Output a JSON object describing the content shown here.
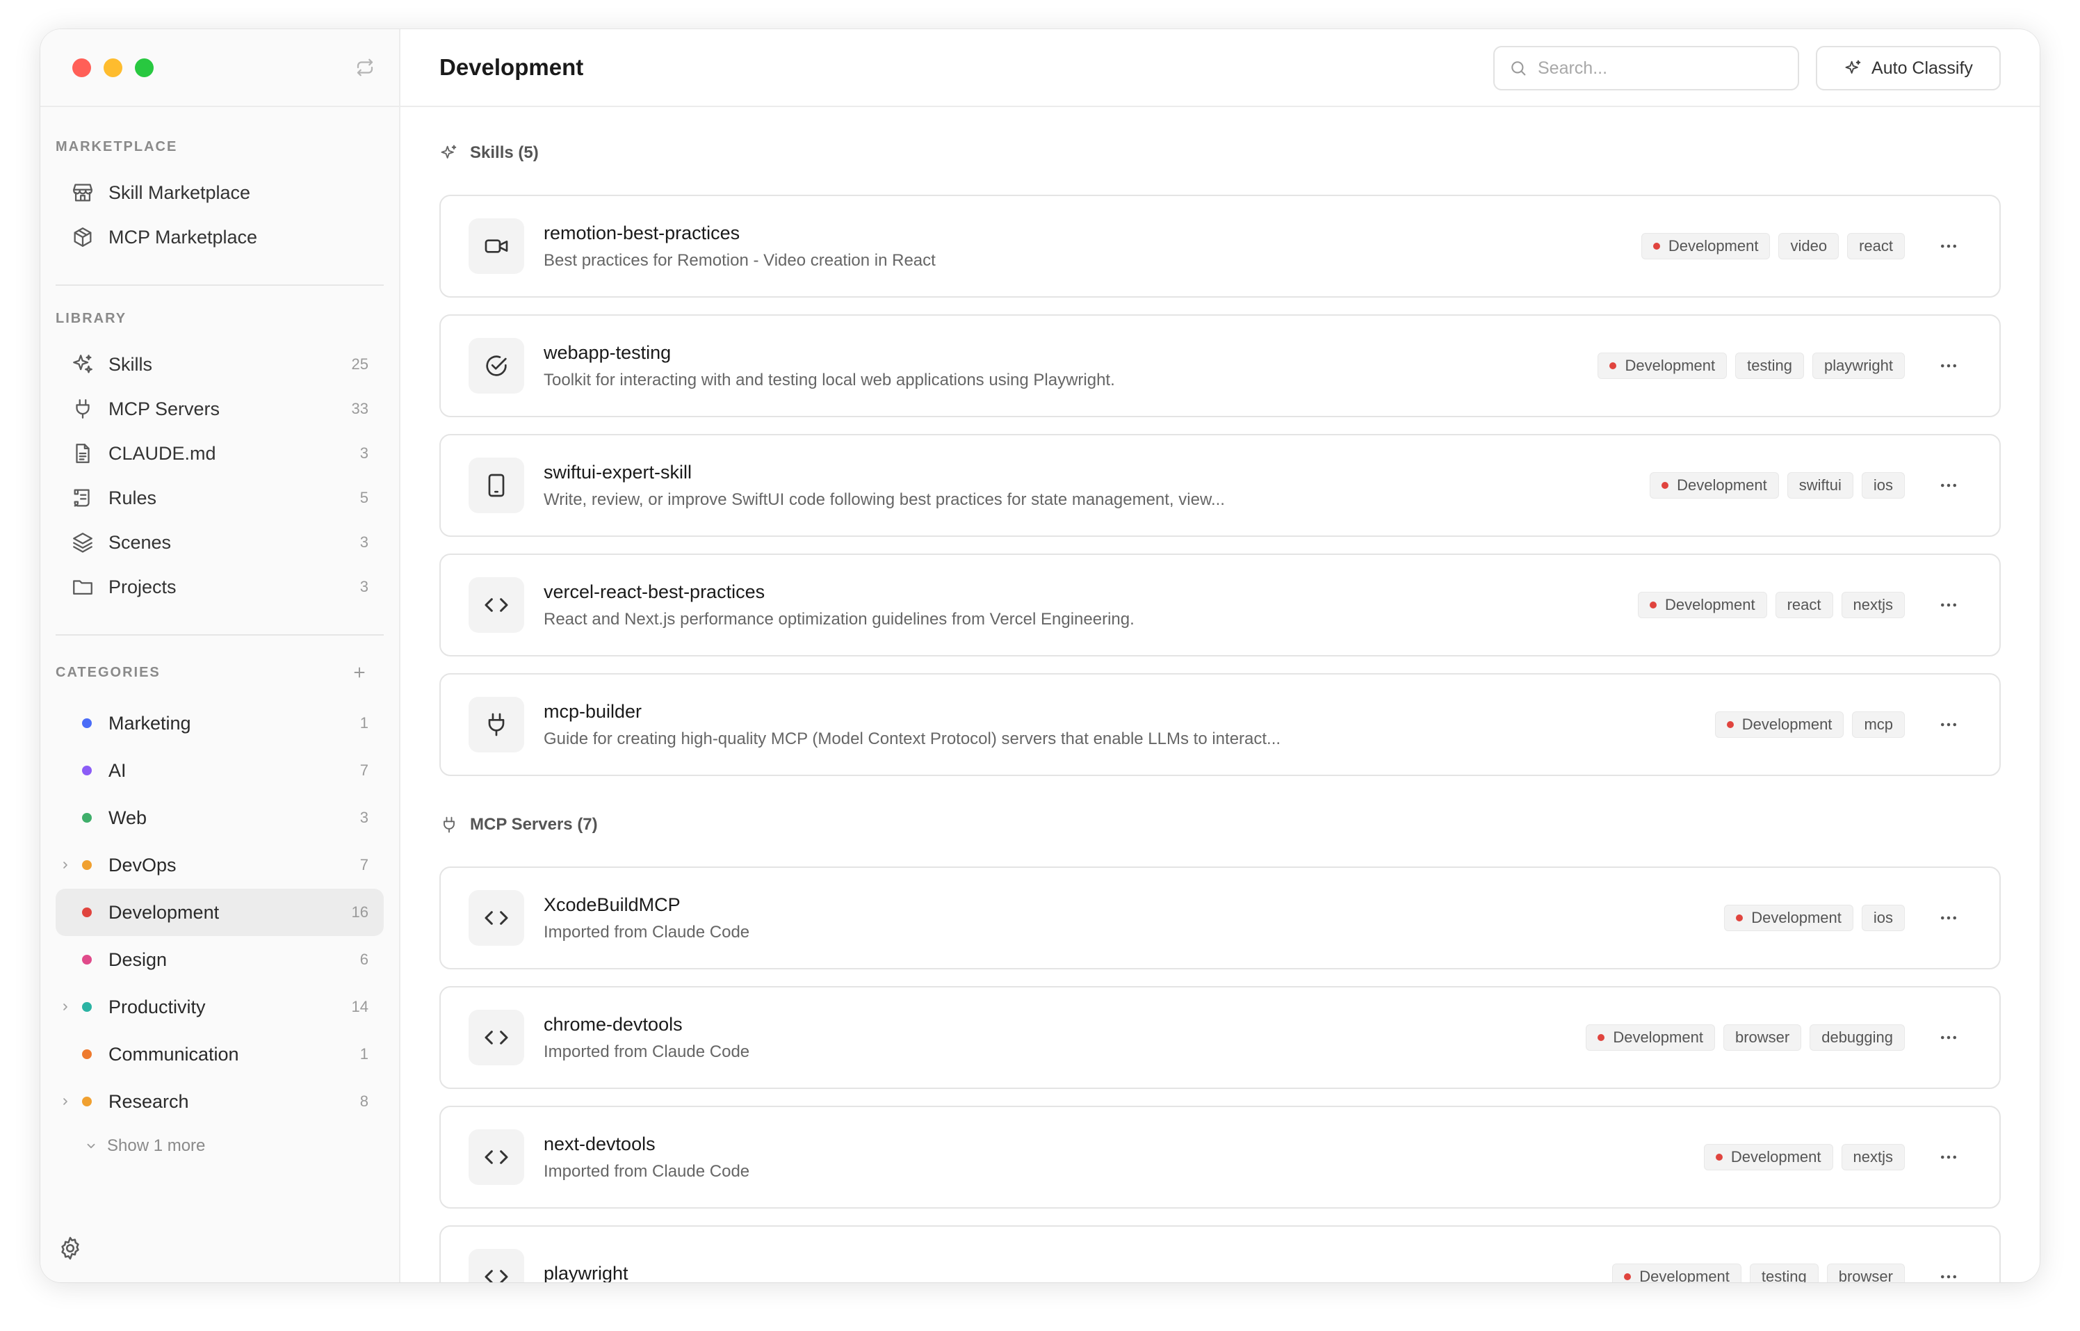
{
  "sidebar": {
    "marketplace_label": "MARKETPLACE",
    "marketplace_items": [
      {
        "label": "Skill Marketplace"
      },
      {
        "label": "MCP Marketplace"
      }
    ],
    "library_label": "LIBRARY",
    "library_items": [
      {
        "label": "Skills",
        "count": "25"
      },
      {
        "label": "MCP Servers",
        "count": "33"
      },
      {
        "label": "CLAUDE.md",
        "count": "3"
      },
      {
        "label": "Rules",
        "count": "5"
      },
      {
        "label": "Scenes",
        "count": "3"
      },
      {
        "label": "Projects",
        "count": "3"
      }
    ],
    "categories_label": "CATEGORIES",
    "categories": [
      {
        "label": "Marketing",
        "count": "1",
        "color": "#4a6cf7"
      },
      {
        "label": "AI",
        "count": "7",
        "color": "#8b5cf6"
      },
      {
        "label": "Web",
        "count": "3",
        "color": "#3fae6a"
      },
      {
        "label": "DevOps",
        "count": "7",
        "color": "#f0a030"
      },
      {
        "label": "Development",
        "count": "16",
        "color": "#e0443e"
      },
      {
        "label": "Design",
        "count": "6",
        "color": "#e04a8a"
      },
      {
        "label": "Productivity",
        "count": "14",
        "color": "#2bb3a3"
      },
      {
        "label": "Communication",
        "count": "1",
        "color": "#ee7a2e"
      },
      {
        "label": "Research",
        "count": "8",
        "color": "#f0a030"
      }
    ],
    "show_more": "Show 1 more"
  },
  "header": {
    "title": "Development",
    "search_placeholder": "Search...",
    "auto_classify": "Auto Classify"
  },
  "skills_section": {
    "title": "Skills (5)",
    "items": [
      {
        "name": "remotion-best-practices",
        "desc": "Best practices for Remotion - Video creation in React",
        "category": "Development",
        "tags": [
          "video",
          "react"
        ],
        "icon": "video-icon"
      },
      {
        "name": "webapp-testing",
        "desc": "Toolkit for interacting with and testing local web applications using Playwright.",
        "category": "Development",
        "tags": [
          "testing",
          "playwright"
        ],
        "icon": "check-circle-icon"
      },
      {
        "name": "swiftui-expert-skill",
        "desc": "Write, review, or improve SwiftUI code following best practices for state management, view...",
        "category": "Development",
        "tags": [
          "swiftui",
          "ios"
        ],
        "icon": "phone-icon"
      },
      {
        "name": "vercel-react-best-practices",
        "desc": "React and Next.js performance optimization guidelines from Vercel Engineering.",
        "category": "Development",
        "tags": [
          "react",
          "nextjs"
        ],
        "icon": "code-icon"
      },
      {
        "name": "mcp-builder",
        "desc": "Guide for creating high-quality MCP (Model Context Protocol) servers that enable LLMs to interact...",
        "category": "Development",
        "tags": [
          "mcp"
        ],
        "icon": "plug-icon"
      }
    ]
  },
  "mcp_section": {
    "title": "MCP Servers (7)",
    "items": [
      {
        "name": "XcodeBuildMCP",
        "desc": "Imported from Claude Code",
        "category": "Development",
        "tags": [
          "ios"
        ],
        "icon": "code-icon"
      },
      {
        "name": "chrome-devtools",
        "desc": "Imported from Claude Code",
        "category": "Development",
        "tags": [
          "browser",
          "debugging"
        ],
        "icon": "code-icon"
      },
      {
        "name": "next-devtools",
        "desc": "Imported from Claude Code",
        "category": "Development",
        "tags": [
          "nextjs"
        ],
        "icon": "code-icon"
      },
      {
        "name": "playwright",
        "desc": "",
        "category": "Development",
        "tags": [
          "testing",
          "browser"
        ],
        "icon": "code-icon"
      }
    ]
  },
  "colors": {
    "development": "#e0443e"
  }
}
